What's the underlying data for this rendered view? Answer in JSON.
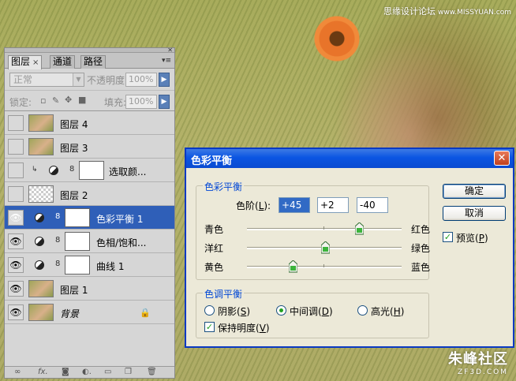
{
  "watermark": {
    "top_text": "思缘设计论坛",
    "top_url": "www.MISSYUAN.com",
    "bottom_name": "朱峰社区",
    "bottom_site": "ZF3D.COM"
  },
  "layers_panel": {
    "tabs": [
      {
        "label": "图层",
        "close": "×"
      },
      {
        "label": "通道"
      },
      {
        "label": "路径"
      }
    ],
    "blend_mode": "正常",
    "opacity_label": "不透明度:",
    "opacity_value": "100%",
    "lock_label": "锁定:",
    "fill_label": "填充:",
    "fill_value": "100%",
    "layers": [
      {
        "name": "图层 4",
        "visible": false
      },
      {
        "name": "图层 3",
        "visible": false
      },
      {
        "name": "选取颜...",
        "visible": false
      },
      {
        "name": "图层 2",
        "visible": false
      },
      {
        "name": "色彩平衡 1",
        "visible": true,
        "selected": true
      },
      {
        "name": "色相/饱和...",
        "visible": true
      },
      {
        "name": "曲线 1",
        "visible": true
      },
      {
        "name": "图层 1",
        "visible": true
      },
      {
        "name": "背景",
        "visible": true
      }
    ],
    "bottom_icons": [
      "link-icon",
      "fx-icon",
      "mask-icon",
      "adjustment-icon",
      "group-icon",
      "new-layer-icon",
      "trash-icon"
    ]
  },
  "dialog": {
    "title": "色彩平衡",
    "close_symbol": "✕",
    "color_balance_group": "色彩平衡",
    "levels_label": "色阶(",
    "levels_key": "L",
    "levels_suffix": "):",
    "levels": [
      "+45",
      "+2",
      "-40"
    ],
    "sliders": [
      {
        "left": "青色",
        "right": "红色",
        "value": 45
      },
      {
        "left": "洋红",
        "right": "绿色",
        "value": 2
      },
      {
        "left": "黄色",
        "right": "蓝色",
        "value": -40
      }
    ],
    "tone_group": "色调平衡",
    "tones": [
      {
        "label": "阴影(",
        "key": "S",
        "suffix": ")",
        "selected": false
      },
      {
        "label": "中间调(",
        "key": "D",
        "suffix": ")",
        "selected": true
      },
      {
        "label": "高光(",
        "key": "H",
        "suffix": ")",
        "selected": false
      }
    ],
    "preserve_label": "保持明度(",
    "preserve_key": "V",
    "preserve_suffix": ")",
    "preserve_checked": true,
    "ok_label": "确定",
    "cancel_label": "取消",
    "preview_label": "预览(",
    "preview_key": "P",
    "preview_suffix": ")",
    "preview_checked": true
  }
}
